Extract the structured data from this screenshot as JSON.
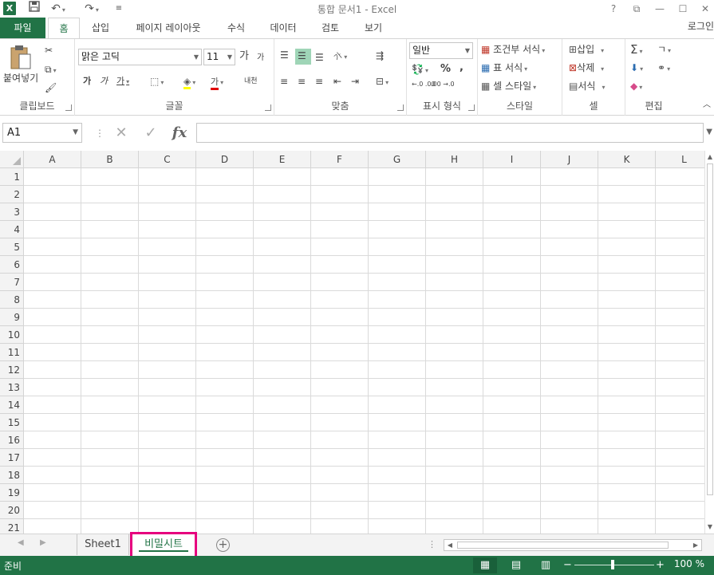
{
  "window": {
    "title": "통합 문서1 - Excel",
    "app_icon": "X",
    "controls": [
      "?",
      "⧉",
      "—",
      "☐",
      "✕"
    ]
  },
  "qat": {
    "save_icon": "save-icon",
    "undo_icon": "undo-icon",
    "redo_icon": "redo-icon"
  },
  "tabs": {
    "file": "파일",
    "items": [
      "홈",
      "삽입",
      "페이지 레이아웃",
      "수식",
      "데이터",
      "검토",
      "보기"
    ],
    "active": "홈",
    "login": "로그인"
  },
  "ribbon": {
    "clipboard": {
      "paste_label": "붙여넣기",
      "group_label": "클립보드"
    },
    "font": {
      "font_name": "맑은 고딕",
      "font_size": "11",
      "grow": "가",
      "shrink": "가",
      "bold": "가",
      "italic": "가",
      "underline": "가",
      "font_color_glyph": "가",
      "phonetic": "내천",
      "group_label": "글꼴"
    },
    "alignment": {
      "group_label": "맞춤",
      "orientation": "가"
    },
    "number": {
      "format": "일반",
      "percent": "%",
      "comma": ",",
      "increase_decimal": "←.0 .00",
      "decrease_decimal": ".00 →.0",
      "group_label": "표시 형식"
    },
    "styles": {
      "conditional": "조건부 서식",
      "as_table": "표 서식",
      "cell_styles": "셀 스타일",
      "group_label": "스타일"
    },
    "cells": {
      "insert": "삽입",
      "delete": "삭제",
      "format": "서식",
      "group_label": "셀"
    },
    "editing": {
      "autosum": "Σ",
      "sort": "ㄱ",
      "group_label": "편집"
    }
  },
  "formula_bar": {
    "name_box": "A1",
    "cancel": "✕",
    "enter": "✓",
    "fx": "fx",
    "value": ""
  },
  "grid": {
    "columns": [
      "A",
      "B",
      "C",
      "D",
      "E",
      "F",
      "G",
      "H",
      "I",
      "J",
      "K",
      "L"
    ],
    "rows": [
      "1",
      "2",
      "3",
      "4",
      "5",
      "6",
      "7",
      "8",
      "9",
      "10",
      "11",
      "12",
      "13",
      "14",
      "15",
      "16",
      "17",
      "18",
      "19",
      "20",
      "21"
    ]
  },
  "sheets": {
    "items": [
      "Sheet1",
      "비밀시트"
    ],
    "active": "비밀시트",
    "add_glyph": "+"
  },
  "status": {
    "ready": "준비",
    "zoom": "100 %",
    "zoom_minus": "−",
    "zoom_plus": "+"
  },
  "colors": {
    "accent": "#217346",
    "highlight": "#e6007e"
  }
}
